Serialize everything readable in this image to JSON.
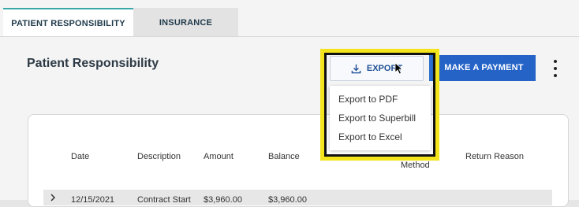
{
  "tabs": [
    {
      "label": "PATIENT RESPONSIBILITY",
      "active": true
    },
    {
      "label": "INSURANCE",
      "active": false
    }
  ],
  "page_title": "Patient Responsibility",
  "actions": {
    "export_label": "EXPORT",
    "export_icon": "download-icon",
    "make_payment_label": "MAKE A PAYMENT",
    "more_icon": "kebab-menu-icon"
  },
  "export_menu": {
    "items": [
      "Export to PDF",
      "Export to Superbill",
      "Export to Excel"
    ]
  },
  "table": {
    "headers": [
      "Date",
      "Description",
      "Amount",
      "Balance",
      "Method",
      "Return Reason"
    ],
    "rows": [
      [
        "12/15/2021",
        "Contract Start",
        "$3,960.00",
        "$3,960.00"
      ]
    ]
  },
  "colors": {
    "accent": "#2563c7",
    "tab_accent": "#3aa8a8",
    "highlight": "#f3e41b"
  }
}
